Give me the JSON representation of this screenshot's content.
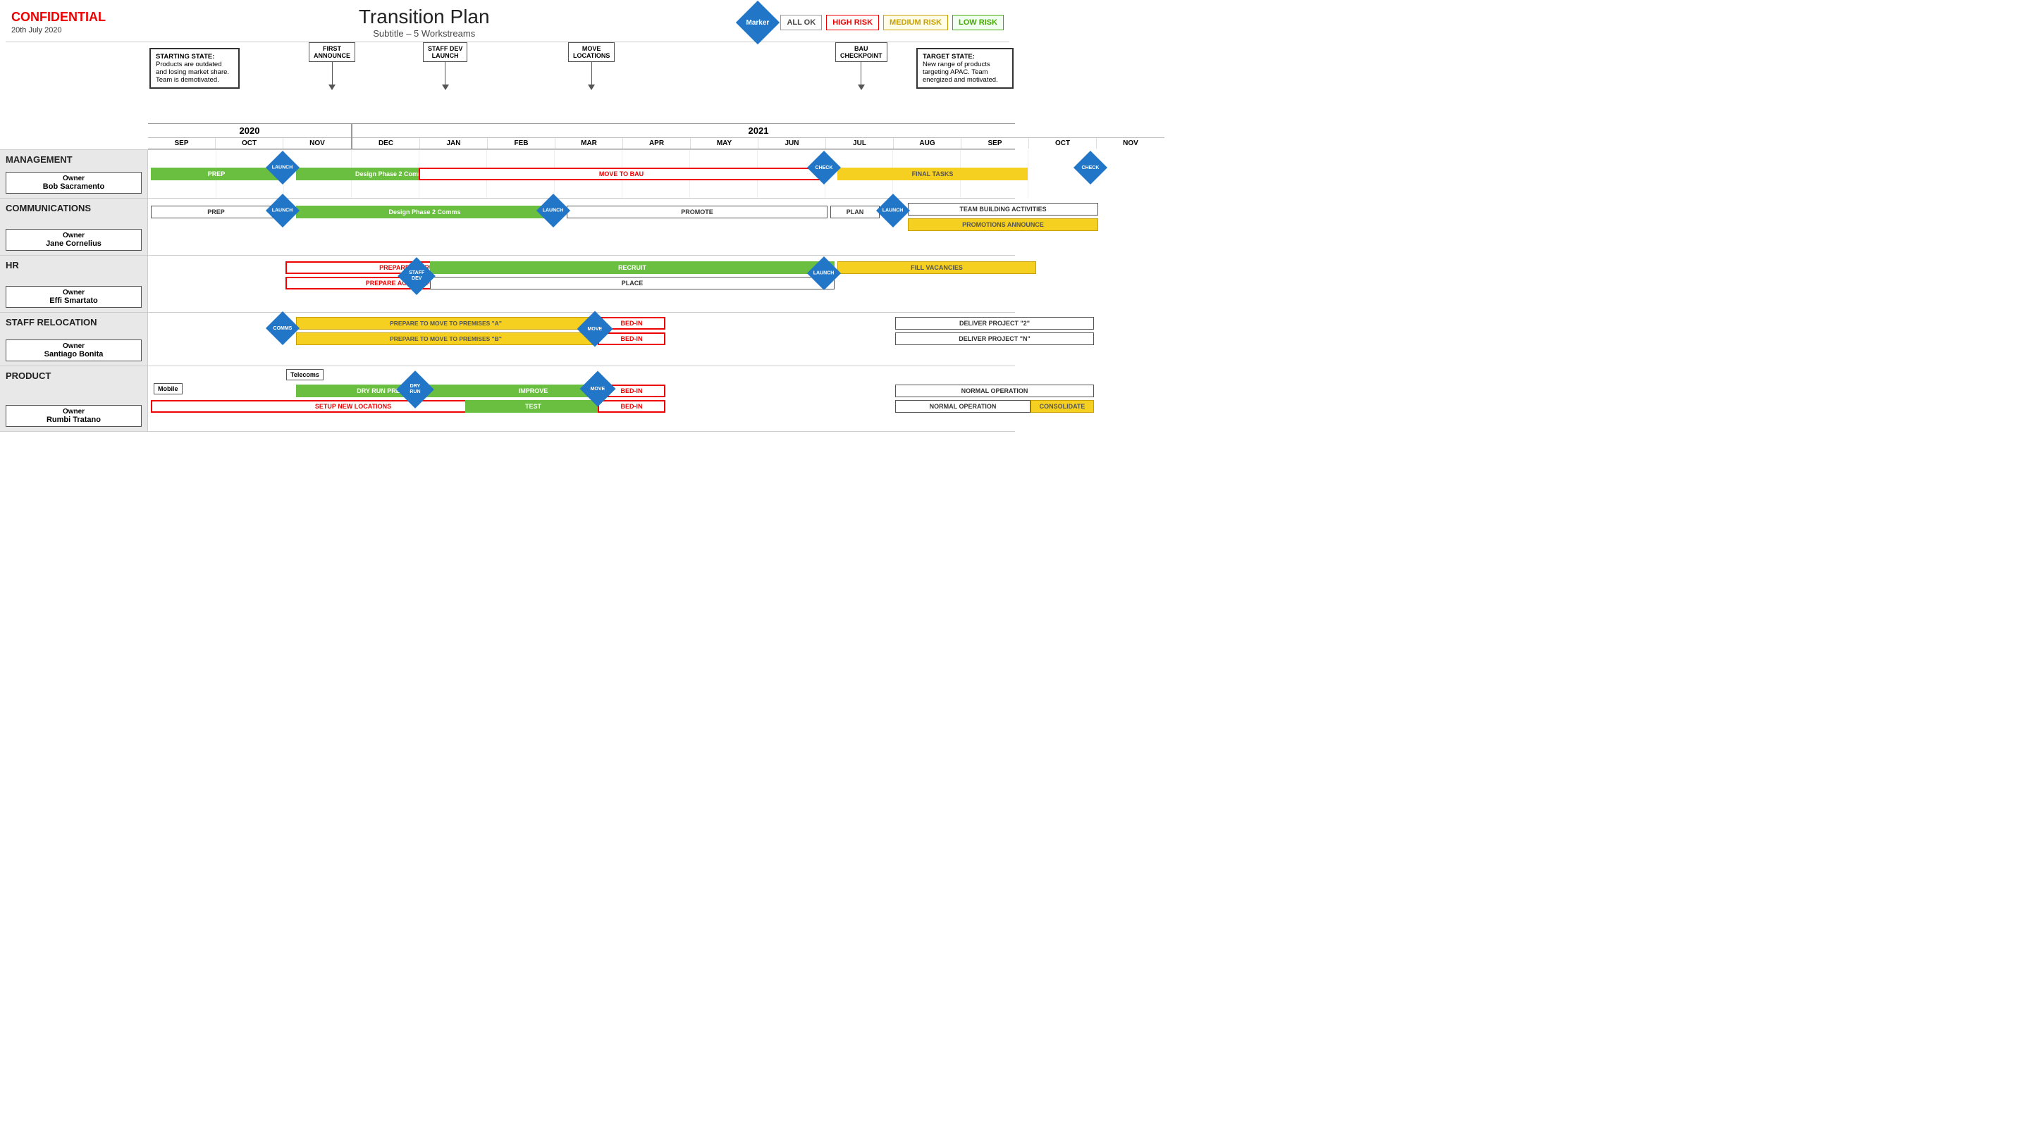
{
  "header": {
    "confidential": "CONFIDENTIAL",
    "date": "20th July 2020",
    "title": "Transition Plan",
    "subtitle": "Subtitle – 5 Workstreams",
    "marker_label": "Marker",
    "all_ok": "ALL OK",
    "high_risk": "HIGH RISK",
    "medium_risk": "MEDIUM RISK",
    "low_risk": "LOW RISK"
  },
  "milestones": [
    {
      "id": "first_announce",
      "label": "FIRST\nANNOUNCE"
    },
    {
      "id": "staff_dev_launch",
      "label": "STAFF DEV\nLAUNCH"
    },
    {
      "id": "move_locations",
      "label": "MOVE\nLOCATIONS"
    },
    {
      "id": "bau_checkpoint",
      "label": "BAU\nCHECKPOINT"
    }
  ],
  "starting_state": {
    "title": "STARTING STATE:",
    "text": "Products are outdated and losing market share. Team is demotivated."
  },
  "target_state": {
    "title": "TARGET STATE:",
    "text": "New range of products targeting APAC. Team energized and motivated."
  },
  "months": {
    "2020": [
      "SEP",
      "OCT",
      "NOV"
    ],
    "2021": [
      "DEC",
      "JAN",
      "FEB",
      "MAR",
      "APR",
      "MAY",
      "JUN",
      "JUL",
      "AUG",
      "SEP",
      "OCT",
      "NOV"
    ]
  },
  "workstreams": [
    {
      "id": "management",
      "name": "MANAGEMENT",
      "owner_title": "Owner",
      "owner_name": "Bob Sacramento"
    },
    {
      "id": "communications",
      "name": "COMMUNICATIONS",
      "owner_title": "Owner",
      "owner_name": "Jane Cornelius"
    },
    {
      "id": "hr",
      "name": "HR",
      "owner_title": "Owner",
      "owner_name": "Effi Smartato"
    },
    {
      "id": "staff_relocation",
      "name": "STAFF RELOCATION",
      "owner_title": "Owner",
      "owner_name": "Santiago Bonita"
    },
    {
      "id": "product",
      "name": "PRODUCT",
      "owner_title": "Owner",
      "owner_name": "Rumbi Tratano"
    }
  ]
}
